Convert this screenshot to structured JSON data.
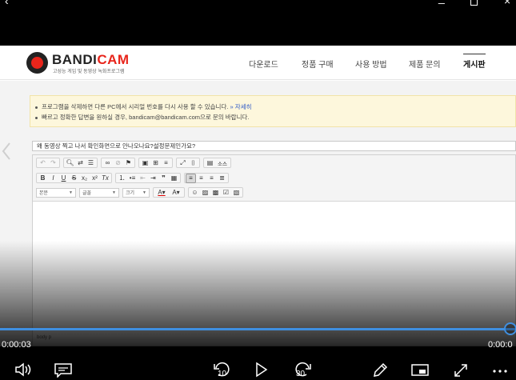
{
  "window": {
    "back_icon": "back-arrow-icon",
    "minimize_icon": "minimize-icon",
    "maximize_icon": "maximize-icon",
    "close_icon": "close-icon"
  },
  "site": {
    "logo_text_left": "BANDI",
    "logo_text_right": "CAM",
    "logo_tagline": "고성능 게임 및 동영상 녹화프로그램",
    "brand_color": "#e8251b",
    "nav": [
      {
        "label": "다운로드"
      },
      {
        "label": "정품 구매"
      },
      {
        "label": "사용 방법"
      },
      {
        "label": "제품 문의"
      },
      {
        "label": "게시판",
        "active": true
      }
    ]
  },
  "notice": {
    "line1": "프로그램을 삭제하면 다른 PC에서 시리얼 번호를 다시 사용 할 수 있습니다.",
    "line1_link": "» 자세히",
    "line2": "빠르고 정확한 답변을 원하실 경우, bandicam@bandicam.com으로 문의 바랍니다."
  },
  "form": {
    "subject_value": "왜 동영상 찍고 나서 확인화면으로 안나오나요?설정문제인가요?"
  },
  "editor": {
    "source_label": "소스",
    "format_dd": "본문",
    "font_dd": "글꼴",
    "size_dd": "크기",
    "status_path": "body  p"
  },
  "player": {
    "current_time": "0:00:03",
    "total_time": "0:00:0",
    "progress": 0.98,
    "skip_back": "10",
    "skip_forward": "30",
    "accent": "#3f8fe0"
  }
}
